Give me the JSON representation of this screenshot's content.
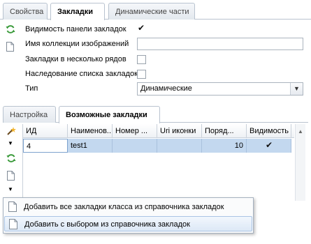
{
  "top_tabs": [
    {
      "label": "Свойства",
      "active": false
    },
    {
      "label": "Закладки",
      "active": true
    },
    {
      "label": "Динамические части",
      "active": false
    }
  ],
  "props": {
    "visibility_label": "Видимость панели закладок",
    "visibility_checked": true,
    "collection_label": "Имя коллекции изображений",
    "collection_value": "",
    "multirow_label": "Закладки в несколько рядов",
    "multirow_checked": false,
    "inherit_label": "Наследование списка закладок",
    "inherit_checked": false,
    "type_label": "Тип",
    "type_value": "Динамические"
  },
  "sub_tabs": [
    {
      "label": "Настройка",
      "active": false
    },
    {
      "label": "Возможные закладки",
      "active": true
    }
  ],
  "grid": {
    "columns": [
      "ИД",
      "Наименов...",
      "Номер ...",
      "Uri иконки",
      "Поряд...",
      "Видимость"
    ],
    "rows": [
      {
        "id": "4",
        "name": "test1",
        "number": "",
        "uri": "",
        "order": "10",
        "visible": true
      }
    ]
  },
  "menu": {
    "items": [
      {
        "label": "Добавить все закладки класса из справочника закладок",
        "highlighted": false
      },
      {
        "label": "Добавить с выбором из справочника закладок",
        "highlighted": true
      }
    ]
  },
  "icons": {
    "refresh": "refresh-icon",
    "document": "document-icon",
    "wand": "magic-wand-icon",
    "dropdown": "dropdown-arrow-icon"
  },
  "colors": {
    "selected_row": "#c3d8ef",
    "refresh_green": "#3a9a3a",
    "menu_highlight": "#dce8f6"
  }
}
